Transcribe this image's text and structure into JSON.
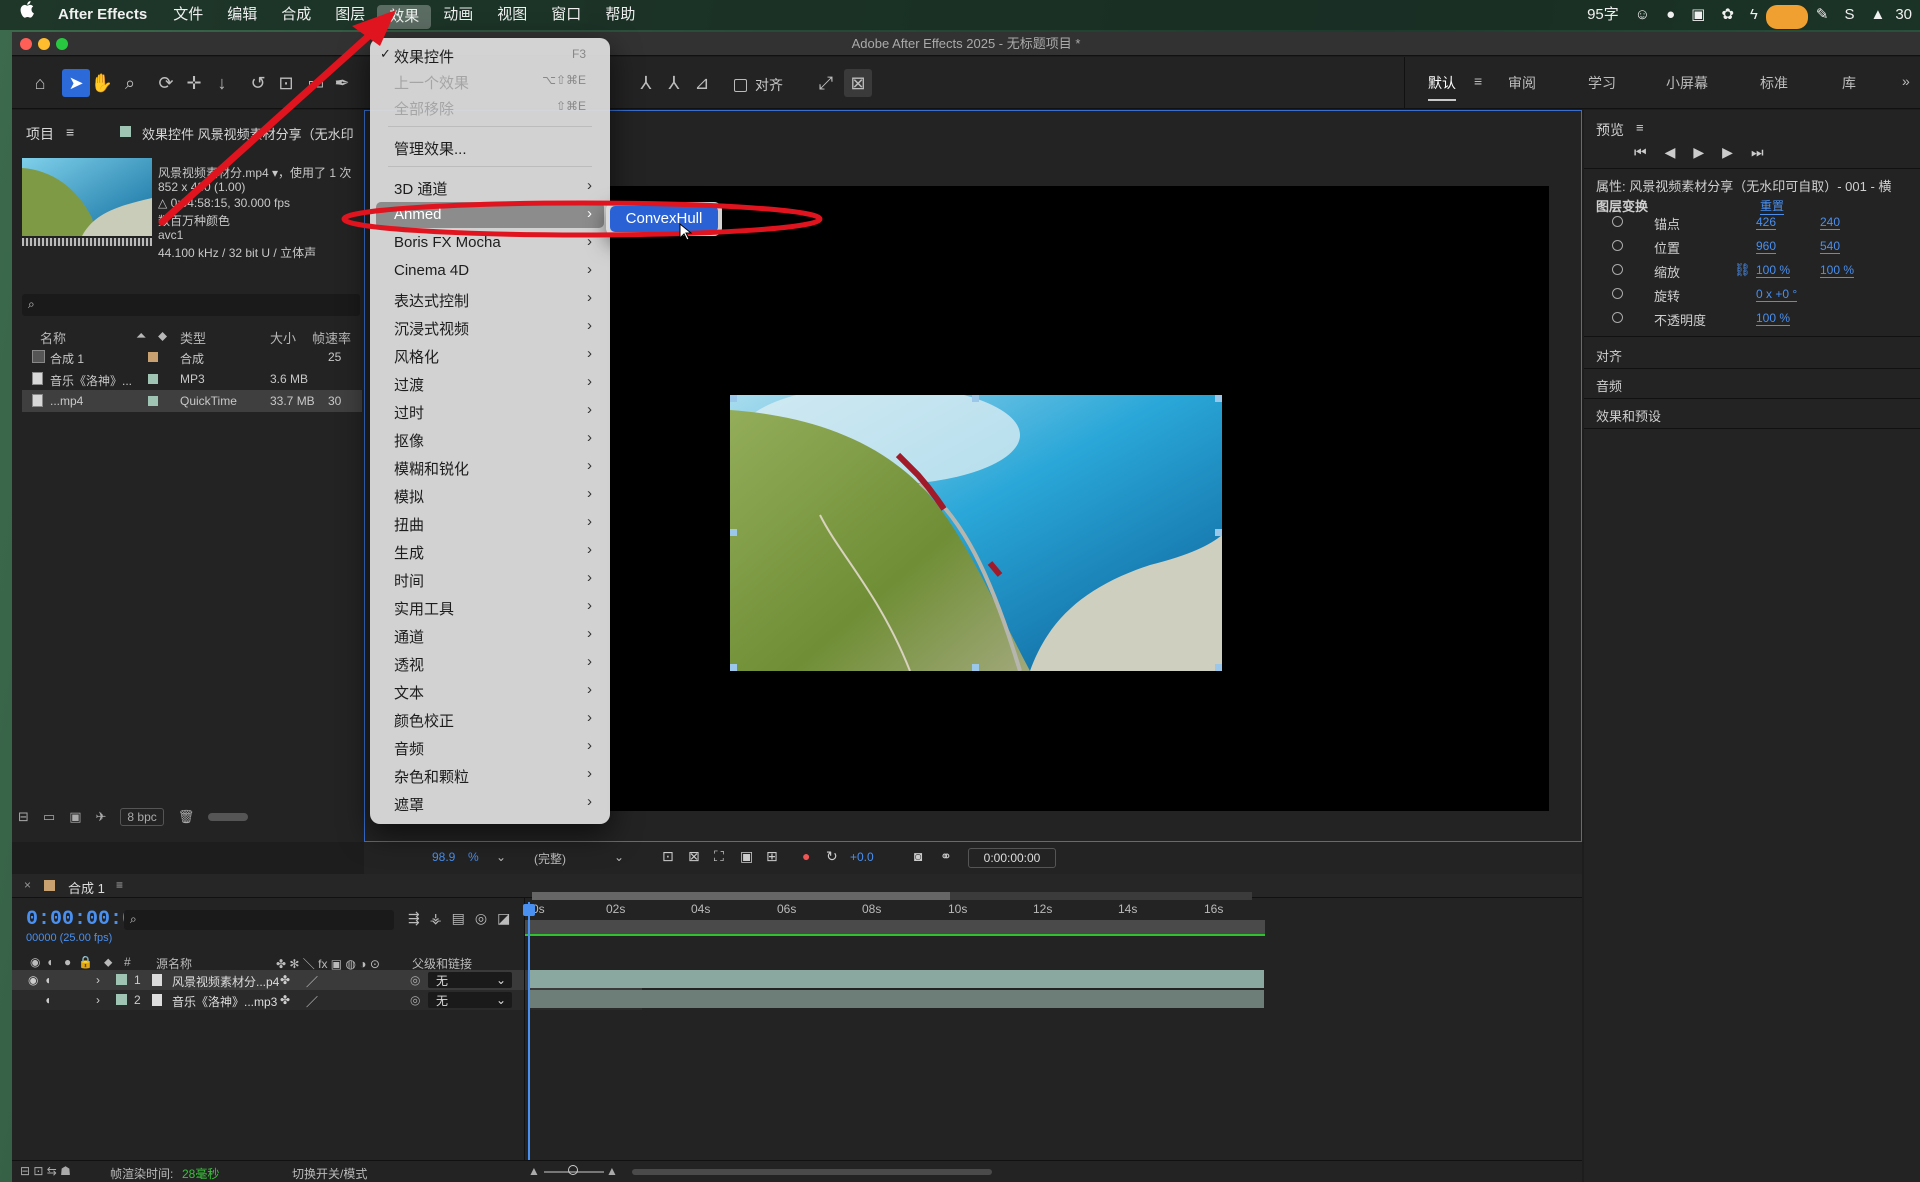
{
  "menubar": {
    "app_name": "After Effects",
    "items": [
      "文件",
      "编辑",
      "合成",
      "图层",
      "效果",
      "动画",
      "视图",
      "窗口",
      "帮助"
    ],
    "active_item": "效果",
    "status": {
      "ime": "95字",
      "time": "30"
    }
  },
  "window": {
    "title": "Adobe After Effects 2025 - 无标题项目 *"
  },
  "toolbar": {
    "snap_label": "对齐",
    "workspaces": [
      "默认",
      "审阅",
      "学习",
      "小屏幕",
      "标准",
      "库"
    ],
    "active_workspace": "默认",
    "more": "»"
  },
  "project_panel": {
    "tab_label": "项目",
    "effect_controls_tab": "效果控件 风景视频素材分享（无水印",
    "footage_name": "风景视频素材分.mp4 ▾，使用了 1 次",
    "footage_size": "852 x 480 (1.00)",
    "footage_duration": "△ 0:04:58:15, 30.000 fps",
    "footage_colors": "数百万种颜色",
    "footage_codec": "avc1",
    "footage_audio": "44.100 kHz / 32 bit U / 立体声",
    "search_placeholder": "",
    "columns": [
      "名称",
      "类型",
      "大小",
      "帧速率"
    ],
    "rows": [
      {
        "name": "合成 1",
        "type": "合成",
        "size": "",
        "fps": "25",
        "color": "#c9a070"
      },
      {
        "name": "音乐《洛神》...",
        "type": "MP3",
        "size": "3.6 MB",
        "fps": "",
        "color": "#9fc4b4"
      },
      {
        "name": "...mp4",
        "type": "QuickTime",
        "size": "33.7 MB",
        "fps": "30",
        "color": "#9fc4b4"
      }
    ],
    "bpc_label": "8 bpc"
  },
  "viewer_bar": {
    "zoom": "98.9",
    "zoom_unit": "%",
    "resolution": "(完整)",
    "exposure": "+0.0",
    "timecode": "0:00:00:00"
  },
  "effects_menu": {
    "items": [
      {
        "label": "效果控件",
        "shortcut": "F3",
        "checked": true,
        "disabled": false,
        "submenu": false
      },
      {
        "label": "上一个效果",
        "shortcut": "⌥⇧⌘E",
        "disabled": true,
        "submenu": false
      },
      {
        "label": "全部移除",
        "shortcut": "⇧⌘E",
        "disabled": true,
        "submenu": false
      },
      {
        "label": "管理效果...",
        "shortcut": "",
        "disabled": false,
        "submenu": false
      },
      {
        "label": "3D 通道",
        "submenu": true
      },
      {
        "label": "Ahmed",
        "submenu": true,
        "highlighted": true
      },
      {
        "label": "Boris FX Mocha",
        "submenu": true
      },
      {
        "label": "Cinema 4D",
        "submenu": true
      },
      {
        "label": "表达式控制",
        "submenu": true
      },
      {
        "label": "沉浸式视频",
        "submenu": true
      },
      {
        "label": "风格化",
        "submenu": true
      },
      {
        "label": "过渡",
        "submenu": true
      },
      {
        "label": "过时",
        "submenu": true
      },
      {
        "label": "抠像",
        "submenu": true
      },
      {
        "label": "模糊和锐化",
        "submenu": true
      },
      {
        "label": "模拟",
        "submenu": true
      },
      {
        "label": "扭曲",
        "submenu": true
      },
      {
        "label": "生成",
        "submenu": true
      },
      {
        "label": "时间",
        "submenu": true
      },
      {
        "label": "实用工具",
        "submenu": true
      },
      {
        "label": "通道",
        "submenu": true
      },
      {
        "label": "透视",
        "submenu": true
      },
      {
        "label": "文本",
        "submenu": true
      },
      {
        "label": "颜色校正",
        "submenu": true
      },
      {
        "label": "音频",
        "submenu": true
      },
      {
        "label": "杂色和颗粒",
        "submenu": true
      },
      {
        "label": "遮罩",
        "submenu": true
      }
    ],
    "submenu_item": "ConvexHull",
    "check_mark": "✓",
    "arrow": "›"
  },
  "right_panel": {
    "preview_title": "预览",
    "properties_title": "属性: 风景视频素材分享（无水印可自取）- 001 - 横",
    "layer_transform": "图层变换",
    "reset": "重置",
    "props": [
      {
        "label": "锚点",
        "v1": "426",
        "v2": "240"
      },
      {
        "label": "位置",
        "v1": "960",
        "v2": "540"
      },
      {
        "label": "缩放",
        "v1": "100 %",
        "v2": "100 %"
      },
      {
        "label": "旋转",
        "v1": "0 x +0 °",
        "v2": ""
      },
      {
        "label": "不透明度",
        "v1": "100 %",
        "v2": ""
      }
    ],
    "sections": [
      "对齐",
      "音频",
      "效果和预设"
    ]
  },
  "timeline": {
    "comp_tab": "合成 1",
    "timecode": "0:00:00:00",
    "frame_info": "00000 (25.00 fps)",
    "col_source": "源名称",
    "col_parent": "父级和链接",
    "layers": [
      {
        "num": "1",
        "name": "风景视频素材分...p4",
        "parent": "无"
      },
      {
        "num": "2",
        "name": "音乐《洛神》...mp3",
        "parent": "无"
      }
    ],
    "ruler": [
      "0s",
      "02s",
      "04s",
      "06s",
      "08s",
      "10s",
      "12s",
      "14s",
      "16s"
    ],
    "render_label": "帧渲染时间:",
    "render_value": "28毫秒",
    "toggle_label": "切换开关/模式"
  },
  "accent_colors": {
    "annotation": "#e0141e",
    "selection": "#2a62d6",
    "timecode": "#4a90f0"
  }
}
